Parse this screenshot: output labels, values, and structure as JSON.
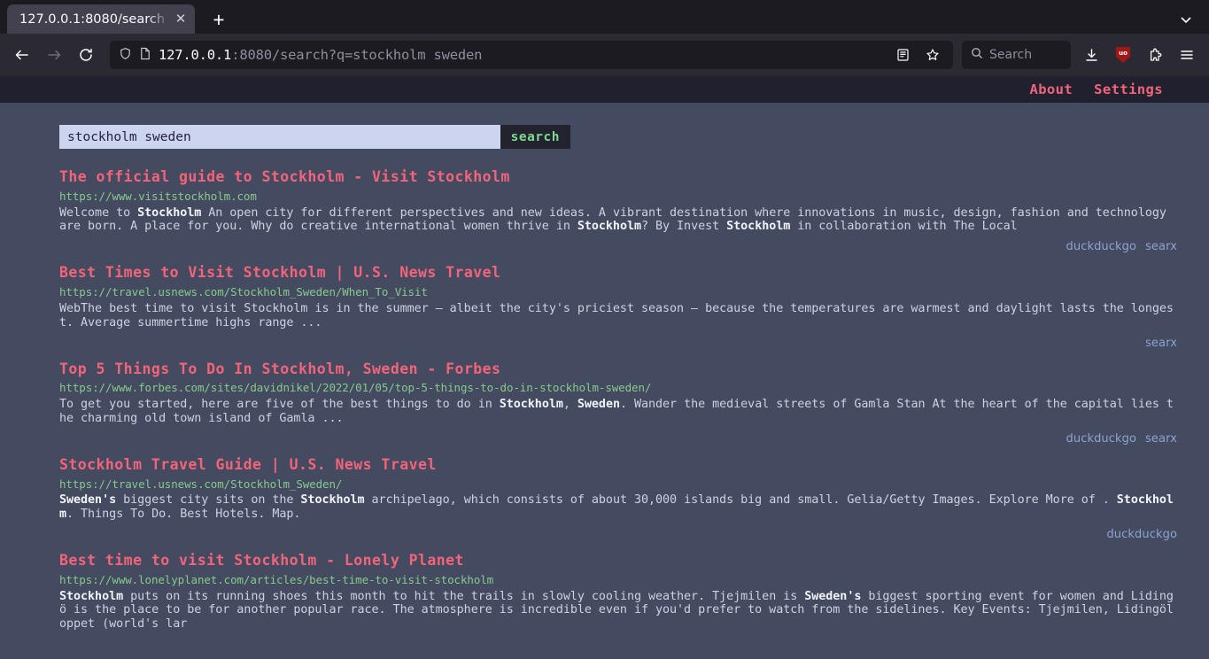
{
  "browser": {
    "tab": {
      "title": "127.0.0.1:8080/search",
      "close_label": "✕"
    },
    "newtab_label": "+",
    "list_all_tabs_label": "⌄",
    "back_label": "←",
    "forward_label": "→",
    "reload_label": "↻",
    "url": {
      "host": "127.0.0.1",
      "rest": ":8080/search?q=stockholm sweden"
    },
    "search_placeholder": "Search",
    "ublock_badge": "uo"
  },
  "site": {
    "nav": [
      {
        "label": "About"
      },
      {
        "label": "Settings"
      }
    ],
    "accent_pink": "#f2647a",
    "accent_green": "#87c98d",
    "page_bg": "#444a60",
    "header_bg": "#20202e"
  },
  "search": {
    "query": "stockholm sweden",
    "placeholder": "",
    "button_label": "search"
  },
  "results": [
    {
      "title": "The official guide to Stockholm - Visit Stockholm",
      "url": "https://www.visitstockholm.com",
      "snippet_html": "Welcome to <b>Stockholm</b> An open city for different perspectives and new ideas. A vibrant destination where innovations in music, design, fashion and technology are born. A place for you. Why do creative international women thrive in <b>Stockholm</b>? By Invest <b>Stockholm</b> in collaboration with The Local",
      "engines": [
        "duckduckgo",
        "searx"
      ]
    },
    {
      "title": "Best Times to Visit Stockholm | U.S. News Travel",
      "url": "https://travel.usnews.com/Stockholm_Sweden/When_To_Visit",
      "snippet_html": "WebThe best time to visit Stockholm is in the summer – albeit the city's priciest season – because the temperatures are warmest and daylight lasts the longest. Average summertime highs range ...",
      "engines": [
        "searx"
      ]
    },
    {
      "title": "Top 5 Things To Do In Stockholm, Sweden - Forbes",
      "url": "https://www.forbes.com/sites/davidnikel/2022/01/05/top-5-things-to-do-in-stockholm-sweden/",
      "snippet_html": "To get you started, here are five of the best things to do in <b>Stockholm</b>, <b>Sweden</b>. Wander the medieval streets of Gamla Stan At the heart of the capital lies the charming old town island of Gamla ...",
      "engines": [
        "duckduckgo",
        "searx"
      ]
    },
    {
      "title": "Stockholm Travel Guide | U.S. News Travel",
      "url": "https://travel.usnews.com/Stockholm_Sweden/",
      "snippet_html": "<b>Sweden's</b> biggest city sits on the <b>Stockholm</b> archipelago, which consists of about 30,000 islands big and small. Gelia/Getty Images. Explore More of . <b>Stockholm</b>. Things To Do. Best Hotels. Map.",
      "engines": [
        "duckduckgo"
      ]
    },
    {
      "title": "Best time to visit Stockholm - Lonely Planet",
      "url": "https://www.lonelyplanet.com/articles/best-time-to-visit-stockholm",
      "snippet_html": "<b>Stockholm</b> puts on its running shoes this month to hit the trails in slowly cooling weather. Tjejmilen is <b>Sweden's</b> biggest sporting event for women and Lidingö is the place to be for another popular race. The atmosphere is incredible even if you'd prefer to watch from the sidelines. Key Events: Tjejmilen, Lidingöloppet (world's lar",
      "engines": []
    }
  ]
}
